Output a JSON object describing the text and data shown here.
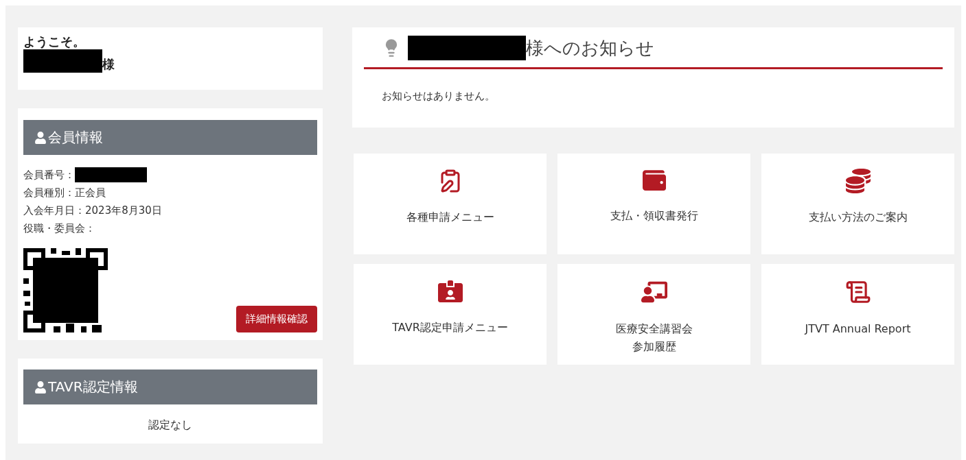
{
  "welcome": {
    "greeting": "ようこそ。",
    "honorific": "様"
  },
  "member_info": {
    "heading": "会員情報",
    "lines": [
      {
        "text": "会員番号：",
        "redacted": true
      },
      {
        "text": "会員種別：正会員",
        "redacted": false
      },
      {
        "text": "入会年月日：2023年8月30日",
        "redacted": false
      },
      {
        "text": "役職・委員会：",
        "redacted": false
      }
    ],
    "button": "詳細情報確認"
  },
  "tavr_info": {
    "heading": "TAVR認定情報",
    "status": "認定なし"
  },
  "notice": {
    "title": "様へのお知らせ",
    "message": "お知らせはありません。"
  },
  "tiles": [
    {
      "lines": [
        "各種申請メニュー"
      ]
    },
    {
      "lines": [
        "支払・領収書発行"
      ]
    },
    {
      "lines": [
        "支払い方法のご案内"
      ]
    },
    {
      "lines": [
        "TAVR認定申請メニュー"
      ]
    },
    {
      "lines": [
        "医療安全講習会",
        "参加履歴"
      ]
    },
    {
      "lines": [
        "JTVT Annual Report"
      ]
    }
  ]
}
